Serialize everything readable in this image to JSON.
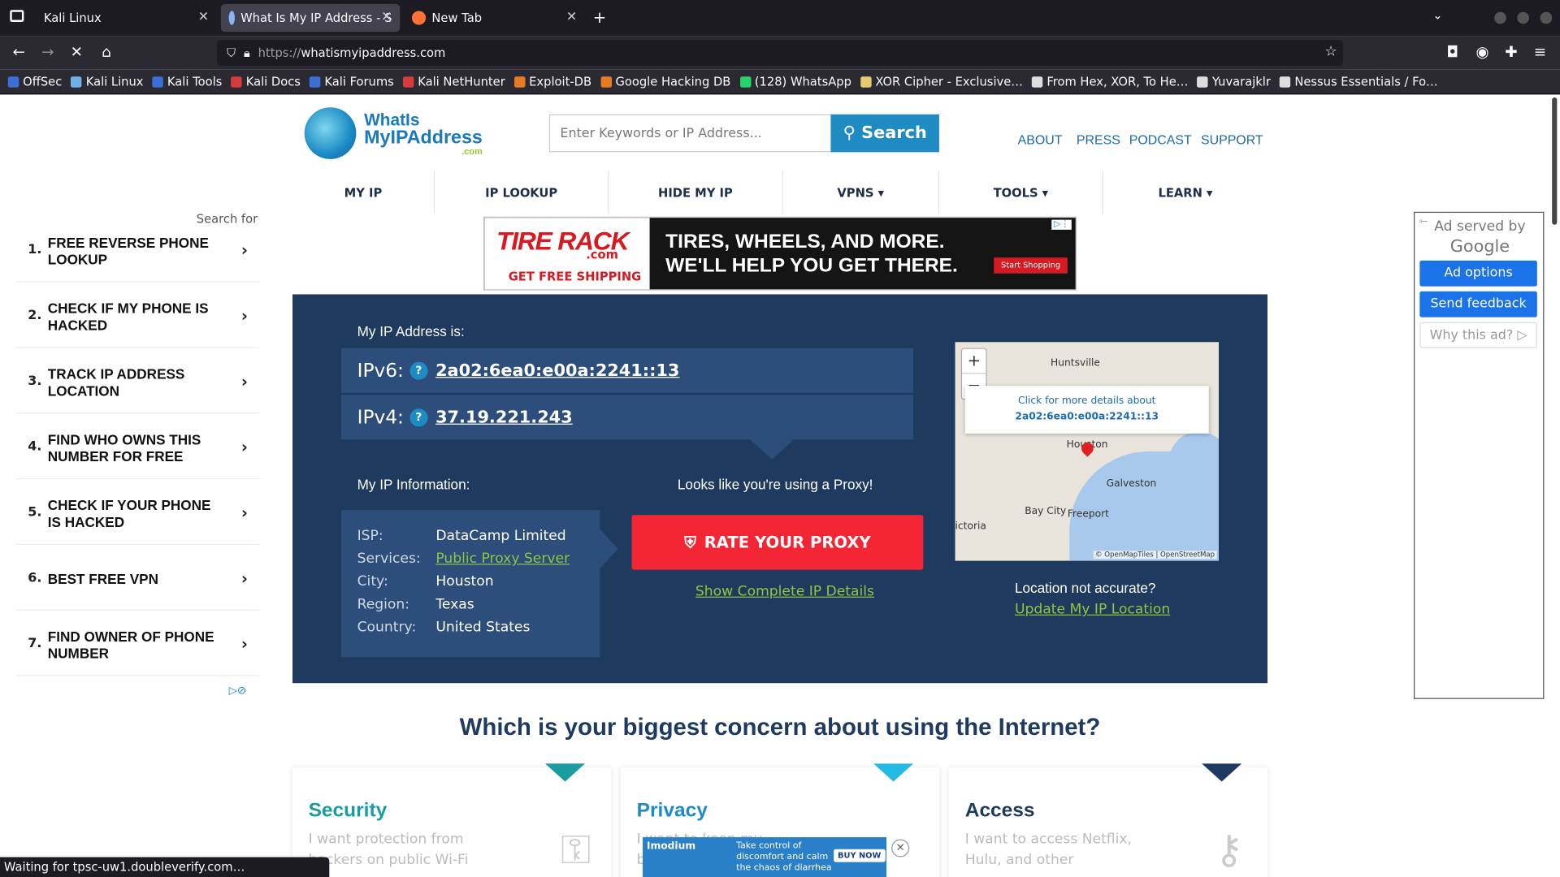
{
  "browser": {
    "tabs": [
      {
        "label": "Kali Linux"
      },
      {
        "label": "What Is My IP Address - S"
      },
      {
        "label": "New Tab"
      }
    ],
    "url_proto": "https://",
    "url_host": "whatismyipaddress.com",
    "status_text": "Waiting for tpsc-uw1.doubleverify.com…"
  },
  "bookmarks": [
    {
      "label": "OffSec",
      "color": "#3b6fd6"
    },
    {
      "label": "Kali Linux",
      "color": "#6fb1e6"
    },
    {
      "label": "Kali Tools",
      "color": "#3b6fd6"
    },
    {
      "label": "Kali Docs",
      "color": "#d63b3b"
    },
    {
      "label": "Kali Forums",
      "color": "#3b6fd6"
    },
    {
      "label": "Kali NetHunter",
      "color": "#d63b3b"
    },
    {
      "label": "Exploit-DB",
      "color": "#e67c22"
    },
    {
      "label": "Google Hacking DB",
      "color": "#e67c22"
    },
    {
      "label": "(128) WhatsApp",
      "color": "#25d366"
    },
    {
      "label": "XOR Cipher - Exclusive…",
      "color": "#e6c86f"
    },
    {
      "label": "From Hex, XOR, To He…",
      "color": "#dddddd"
    },
    {
      "label": "Yuvarajklr",
      "color": "#dddddd"
    },
    {
      "label": "Nessus Essentials / Fo…",
      "color": "#dddddd"
    }
  ],
  "site": {
    "logo": {
      "l1": "WhatIs",
      "l2": "MyIPAddress",
      "l3": ".com"
    },
    "search_placeholder": "Enter Keywords or IP Address...",
    "search_button": "Search",
    "top_links": [
      "ABOUT",
      "PRESS",
      "PODCAST",
      "SUPPORT"
    ],
    "nav": [
      "MY IP",
      "IP LOOKUP",
      "HIDE MY IP",
      "VPNS ▾",
      "TOOLS ▾",
      "LEARN ▾"
    ]
  },
  "banner_ad": {
    "brand": "TIRE RACK",
    "brand_suffix": ".com",
    "shipping": "GET FREE SHIPPING",
    "headline1": "TIRES, WHEELS, AND MORE.",
    "headline2": "WE'LL HELP YOU GET THERE.",
    "cta": "Start Shopping"
  },
  "left_ad": {
    "search_for": "Search for",
    "items": [
      {
        "num": "1.",
        "text": "FREE REVERSE PHONE LOOKUP"
      },
      {
        "num": "2.",
        "text": "CHECK IF MY PHONE IS HACKED"
      },
      {
        "num": "3.",
        "text": "TRACK IP ADDRESS LOCATION"
      },
      {
        "num": "4.",
        "text": "FIND WHO OWNS THIS NUMBER FOR FREE"
      },
      {
        "num": "5.",
        "text": "CHECK IF YOUR PHONE IS HACKED"
      },
      {
        "num": "6.",
        "text": "BEST FREE VPN"
      },
      {
        "num": "7.",
        "text": "FIND OWNER OF PHONE NUMBER"
      }
    ]
  },
  "ip": {
    "heading": "My IP Address is:",
    "ipv6_label": "IPv6:",
    "ipv6": "2a02:6ea0:e00a:2241::13",
    "ipv4_label": "IPv4:",
    "ipv4": "37.19.221.243",
    "info_heading": "My IP Information:",
    "info": [
      {
        "k": "ISP:",
        "v": "DataCamp Limited",
        "link": false
      },
      {
        "k": "Services:",
        "v": "Public Proxy Server",
        "link": true
      },
      {
        "k": "City:",
        "v": "Houston",
        "link": false
      },
      {
        "k": "Region:",
        "v": "Texas",
        "link": false
      },
      {
        "k": "Country:",
        "v": "United States",
        "link": false
      }
    ],
    "proxy_msg": "Looks like you're using a Proxy!",
    "proxy_button": "RATE YOUR PROXY",
    "show_details": "Show Complete IP Details",
    "loc_question": "Location not accurate?",
    "loc_update": "Update My IP Location"
  },
  "map": {
    "popup_line1": "Click for more details about",
    "popup_line2": "2a02:6ea0:e00a:2241::13",
    "labels": [
      "Huntsville",
      "Houston",
      "Galveston",
      "Bay City",
      "Freeport",
      "ictoria"
    ],
    "attribution": "© OpenMapTiles | OpenStreetMap"
  },
  "right_ad": {
    "served_by": "Ad served by",
    "google": "Google",
    "buttons": [
      "Ad options",
      "Send feedback",
      "Why this ad? ▷"
    ]
  },
  "concern": {
    "heading": "Which is your biggest concern about using the Internet?",
    "cards": [
      {
        "title": "Security",
        "desc": "I want protection from hackers on public Wi-Fi",
        "color": "#1a9ca0"
      },
      {
        "title": "Privacy",
        "desc": "I want to keep my browsing private",
        "color": "#1e8bc3"
      },
      {
        "title": "Access",
        "desc": "I want to access Netflix, Hulu, and other",
        "color": "#1f3a5f"
      }
    ]
  },
  "bottom_ad": {
    "brand": "Imodium",
    "msg": "Take control of discomfort and calm the chaos of diarrhea",
    "cta": "BUY NOW"
  }
}
